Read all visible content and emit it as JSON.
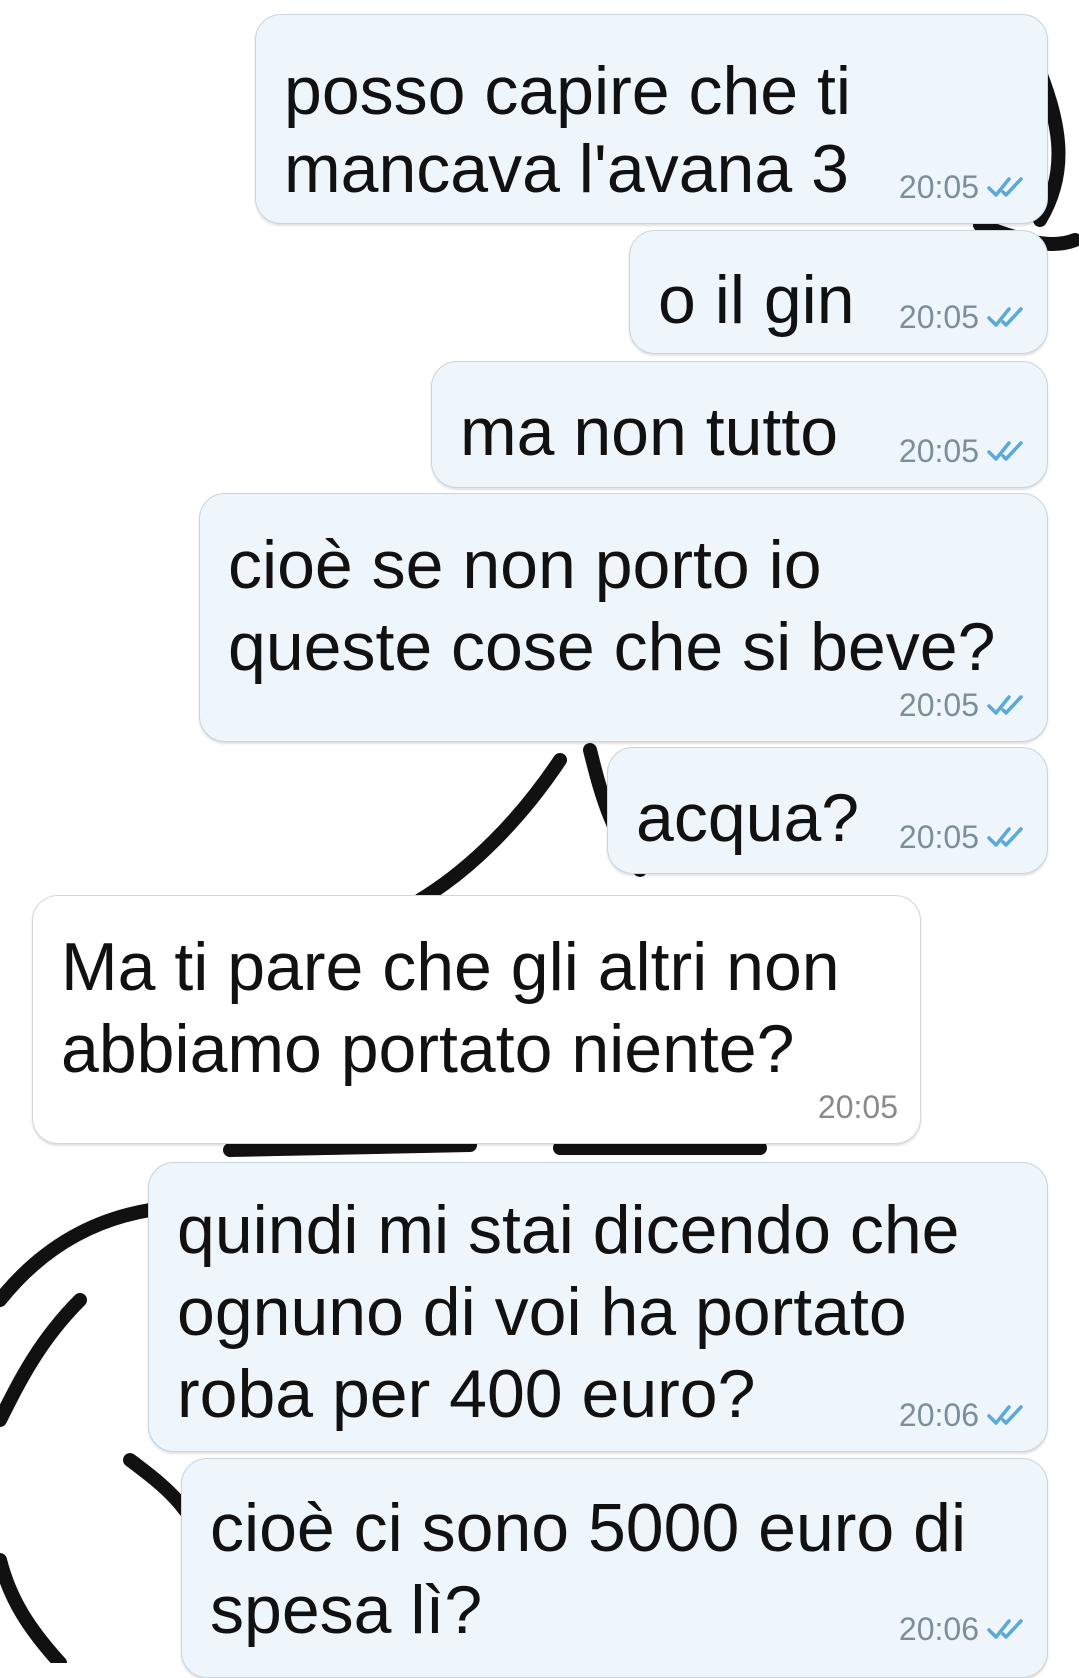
{
  "messages": [
    {
      "direction": "out",
      "lines": [
        "posso capire che ti",
        "mancava l'avana 3"
      ],
      "time": "20:05",
      "status": "read"
    },
    {
      "direction": "out",
      "lines": [
        "o il gin"
      ],
      "time": "20:05",
      "status": "read"
    },
    {
      "direction": "out",
      "lines": [
        "ma non tutto"
      ],
      "time": "20:05",
      "status": "read"
    },
    {
      "direction": "out",
      "lines": [
        "cioè se non porto io",
        "queste cose che si beve?"
      ],
      "time": "20:05",
      "status": "read"
    },
    {
      "direction": "out",
      "lines": [
        "acqua?"
      ],
      "time": "20:05",
      "status": "read"
    },
    {
      "direction": "in",
      "lines": [
        "Ma ti pare che gli altri non",
        "abbiamo portato niente?"
      ],
      "time": "20:05"
    },
    {
      "direction": "out",
      "lines": [
        "quindi mi stai dicendo che",
        "ognuno di voi ha portato",
        "roba per 400 euro?"
      ],
      "time": "20:06",
      "status": "read"
    },
    {
      "direction": "out",
      "lines": [
        "cioè ci sono 5000 euro di",
        "spesa lì?"
      ],
      "time": "20:06",
      "status": "read"
    }
  ],
  "icons": {
    "read_receipt": "double-check-icon"
  },
  "colors": {
    "outgoing_bubble": "#eef6fb",
    "incoming_bubble": "#ffffff",
    "tick": "#5aa9d8",
    "time": "#7d8e98"
  }
}
